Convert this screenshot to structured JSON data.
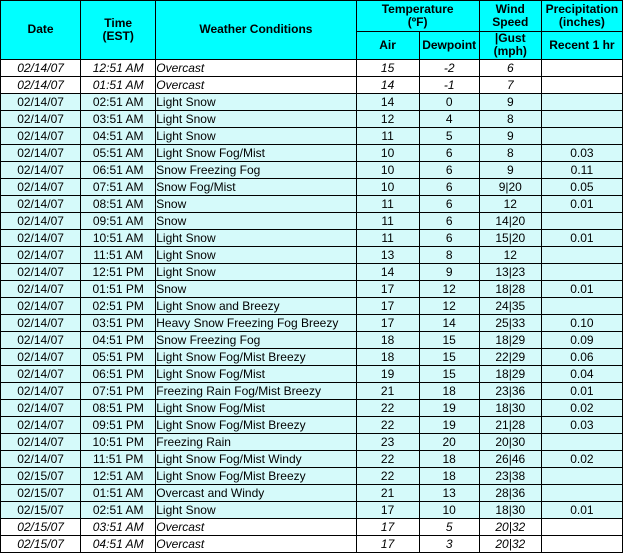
{
  "table": {
    "colors": {
      "header_background": "#00FFFF",
      "shaded_row_background": "#D5FAFA",
      "plain_row_background": "#FFFFFF",
      "border": "#000000",
      "text": "#000000"
    },
    "headers": {
      "date": "Date",
      "time": "Time\n(EST)",
      "time_line1": "Time",
      "time_line2": "(EST)",
      "conditions": "Weather Conditions",
      "temperature_group_line1": "Temperature",
      "temperature_group_line2": "(ºF)",
      "air": "Air",
      "dewpoint": "Dewpoint",
      "wind_group_line1": "Wind",
      "wind_group_line2": "Speed",
      "wind_sub_line1": "|Gust",
      "wind_sub_line2": "(mph)",
      "precip_group_line1": "Precipitation",
      "precip_group_line2": "(inches)",
      "precip_sub": "Recent 1 hr"
    },
    "rows": [
      {
        "date": "02/14/07",
        "time": "12:51 AM",
        "conditions": "Overcast",
        "air": "15",
        "dewpoint": "-2",
        "wind": "6",
        "precip": "",
        "style": "plain-italic"
      },
      {
        "date": "02/14/07",
        "time": "01:51 AM",
        "conditions": "Overcast",
        "air": "14",
        "dewpoint": "-1",
        "wind": "7",
        "precip": "",
        "style": "plain-italic"
      },
      {
        "date": "02/14/07",
        "time": "02:51 AM",
        "conditions": "Light Snow",
        "air": "14",
        "dewpoint": "0",
        "wind": "9",
        "precip": "",
        "style": "shaded"
      },
      {
        "date": "02/14/07",
        "time": "03:51 AM",
        "conditions": "Light Snow",
        "air": "12",
        "dewpoint": "4",
        "wind": "8",
        "precip": "",
        "style": "shaded"
      },
      {
        "date": "02/14/07",
        "time": "04:51 AM",
        "conditions": "Light Snow",
        "air": "11",
        "dewpoint": "5",
        "wind": "9",
        "precip": "",
        "style": "shaded"
      },
      {
        "date": "02/14/07",
        "time": "05:51 AM",
        "conditions": "Light Snow Fog/Mist",
        "air": "10",
        "dewpoint": "6",
        "wind": "8",
        "precip": "0.03",
        "style": "shaded"
      },
      {
        "date": "02/14/07",
        "time": "06:51 AM",
        "conditions": "Snow Freezing Fog",
        "air": "10",
        "dewpoint": "6",
        "wind": "9",
        "precip": "0.11",
        "style": "shaded"
      },
      {
        "date": "02/14/07",
        "time": "07:51 AM",
        "conditions": "Snow Fog/Mist",
        "air": "10",
        "dewpoint": "6",
        "wind": "9|20",
        "precip": "0.05",
        "style": "shaded"
      },
      {
        "date": "02/14/07",
        "time": "08:51 AM",
        "conditions": "Snow",
        "air": "11",
        "dewpoint": "6",
        "wind": "12",
        "precip": "0.01",
        "style": "shaded"
      },
      {
        "date": "02/14/07",
        "time": "09:51 AM",
        "conditions": "Snow",
        "air": "11",
        "dewpoint": "6",
        "wind": "14|20",
        "precip": "",
        "style": "shaded"
      },
      {
        "date": "02/14/07",
        "time": "10:51 AM",
        "conditions": "Light Snow",
        "air": "11",
        "dewpoint": "6",
        "wind": "15|20",
        "precip": "0.01",
        "style": "shaded"
      },
      {
        "date": "02/14/07",
        "time": "11:51 AM",
        "conditions": "Light Snow",
        "air": "13",
        "dewpoint": "8",
        "wind": "12",
        "precip": "",
        "style": "shaded"
      },
      {
        "date": "02/14/07",
        "time": "12:51 PM",
        "conditions": "Light Snow",
        "air": "14",
        "dewpoint": "9",
        "wind": "13|23",
        "precip": "",
        "style": "shaded"
      },
      {
        "date": "02/14/07",
        "time": "01:51 PM",
        "conditions": "Snow",
        "air": "17",
        "dewpoint": "12",
        "wind": "18|28",
        "precip": "0.01",
        "style": "shaded"
      },
      {
        "date": "02/14/07",
        "time": "02:51 PM",
        "conditions": "Light Snow and Breezy",
        "air": "17",
        "dewpoint": "12",
        "wind": "24|35",
        "precip": "",
        "style": "shaded"
      },
      {
        "date": "02/14/07",
        "time": "03:51 PM",
        "conditions": "Heavy Snow Freezing Fog Breezy",
        "air": "17",
        "dewpoint": "14",
        "wind": "25|33",
        "precip": "0.10",
        "style": "shaded"
      },
      {
        "date": "02/14/07",
        "time": "04:51 PM",
        "conditions": "Snow Freezing Fog",
        "air": "18",
        "dewpoint": "15",
        "wind": "18|29",
        "precip": "0.09",
        "style": "shaded"
      },
      {
        "date": "02/14/07",
        "time": "05:51 PM",
        "conditions": "Light Snow Fog/Mist Breezy",
        "air": "18",
        "dewpoint": "15",
        "wind": "22|29",
        "precip": "0.06",
        "style": "shaded"
      },
      {
        "date": "02/14/07",
        "time": "06:51 PM",
        "conditions": "Light Snow Fog/Mist",
        "air": "19",
        "dewpoint": "15",
        "wind": "18|29",
        "precip": "0.04",
        "style": "shaded"
      },
      {
        "date": "02/14/07",
        "time": "07:51 PM",
        "conditions": "Freezing Rain Fog/Mist Breezy",
        "air": "21",
        "dewpoint": "18",
        "wind": "23|36",
        "precip": "0.01",
        "style": "shaded"
      },
      {
        "date": "02/14/07",
        "time": "08:51 PM",
        "conditions": "Light Snow Fog/Mist",
        "air": "22",
        "dewpoint": "19",
        "wind": "18|30",
        "precip": "0.02",
        "style": "shaded"
      },
      {
        "date": "02/14/07",
        "time": "09:51 PM",
        "conditions": "Light Snow Fog/Mist Breezy",
        "air": "22",
        "dewpoint": "19",
        "wind": "21|28",
        "precip": "0.03",
        "style": "shaded"
      },
      {
        "date": "02/14/07",
        "time": "10:51 PM",
        "conditions": "Freezing Rain",
        "air": "23",
        "dewpoint": "20",
        "wind": "20|30",
        "precip": "",
        "style": "shaded"
      },
      {
        "date": "02/14/07",
        "time": "11:51 PM",
        "conditions": "Light Snow Fog/Mist Windy",
        "air": "22",
        "dewpoint": "18",
        "wind": "26|46",
        "precip": "0.02",
        "style": "shaded"
      },
      {
        "date": "02/15/07",
        "time": "12:51 AM",
        "conditions": "Light Snow Fog/Mist Breezy",
        "air": "22",
        "dewpoint": "18",
        "wind": "23|38",
        "precip": "",
        "style": "shaded"
      },
      {
        "date": "02/15/07",
        "time": "01:51 AM",
        "conditions": "Overcast and Windy",
        "air": "21",
        "dewpoint": "13",
        "wind": "28|36",
        "precip": "",
        "style": "shaded"
      },
      {
        "date": "02/15/07",
        "time": "02:51 AM",
        "conditions": "Light Snow",
        "air": "17",
        "dewpoint": "10",
        "wind": "18|30",
        "precip": "0.01",
        "style": "shaded"
      },
      {
        "date": "02/15/07",
        "time": "03:51 AM",
        "conditions": "Overcast",
        "air": "17",
        "dewpoint": "5",
        "wind": "20|32",
        "precip": "",
        "style": "plain-italic"
      },
      {
        "date": "02/15/07",
        "time": "04:51 AM",
        "conditions": "Overcast",
        "air": "17",
        "dewpoint": "3",
        "wind": "20|32",
        "precip": "",
        "style": "plain-italic"
      }
    ]
  }
}
